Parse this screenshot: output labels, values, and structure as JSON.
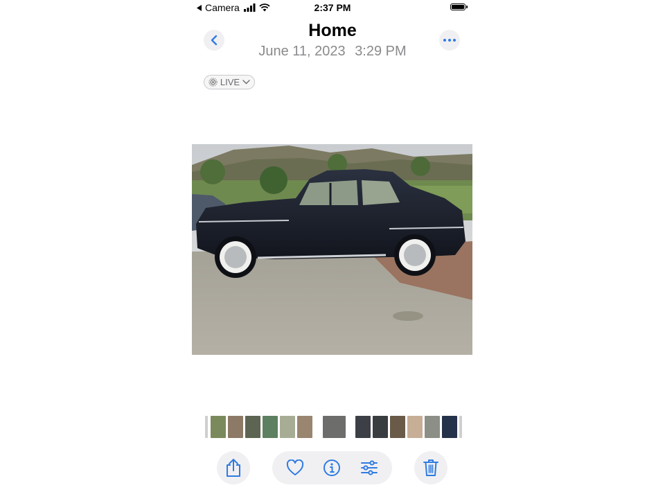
{
  "status_bar": {
    "back_app_label": "Camera",
    "time": "2:37 PM"
  },
  "header": {
    "title": "Home",
    "date": "June 11, 2023",
    "time": "3:29 PM",
    "back_icon": "chevron-left-icon",
    "more_icon": "ellipsis-icon"
  },
  "live_badge": {
    "label": "LIVE",
    "icon": "live-photo-icon"
  },
  "photo": {
    "subject": "vintage black coupe car on driveway"
  },
  "thumbnails": {
    "selected_index": 6,
    "colors": [
      "#7a8a5c",
      "#8c7a66",
      "#5e6452",
      "#5d8060",
      "#a7ad95",
      "#9a8570",
      "#6d6e6c",
      "#3c4046",
      "#3a3d40",
      "#6a5a48",
      "#c7ae96",
      "#8c8f86",
      "#25334a"
    ]
  },
  "toolbar": {
    "share_icon": "share-icon",
    "favorite_icon": "heart-icon",
    "info_icon": "info-icon",
    "adjust_icon": "sliders-icon",
    "delete_icon": "trash-icon"
  },
  "colors": {
    "accent": "#2f7be0",
    "secondary_text": "#8a8a8e",
    "button_bg": "#f0f0f3"
  }
}
